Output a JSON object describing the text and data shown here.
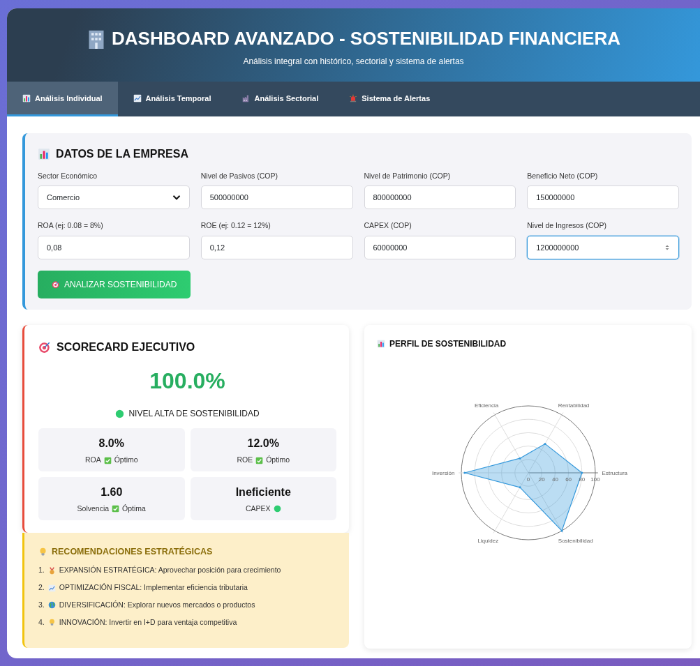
{
  "header": {
    "title": "DASHBOARD AVANZADO - SOSTENIBILIDAD FINANCIERA",
    "subtitle": "Análisis integral con histórico, sectorial y sistema de alertas"
  },
  "tabs": [
    {
      "label": "Análisis Individual",
      "selected": true,
      "kind": "bars"
    },
    {
      "label": "Análisis Temporal",
      "selected": false,
      "kind": "trend"
    },
    {
      "label": "Análisis Sectorial",
      "selected": false,
      "kind": "factory"
    },
    {
      "label": "Sistema de Alertas",
      "selected": false,
      "kind": "siren"
    }
  ],
  "form": {
    "title": "DATOS DE LA EMPRESA",
    "fields": [
      {
        "label": "Sector Económico",
        "kind": "select",
        "value": "Comercio",
        "focused": false
      },
      {
        "label": "Nivel de Pasivos (COP)",
        "kind": "text",
        "value": "500000000",
        "focused": false
      },
      {
        "label": "Nivel de Patrimonio (COP)",
        "kind": "text",
        "value": "800000000",
        "focused": false
      },
      {
        "label": "Beneficio Neto (COP)",
        "kind": "text",
        "value": "150000000",
        "focused": false
      },
      {
        "label": "ROA (ej: 0.08 = 8%)",
        "kind": "text",
        "value": "0,08",
        "focused": false
      },
      {
        "label": "ROE (ej: 0.12 = 12%)",
        "kind": "text",
        "value": "0,12",
        "focused": false
      },
      {
        "label": "CAPEX (COP)",
        "kind": "text",
        "value": "60000000",
        "focused": false
      },
      {
        "label": "Nivel de Ingresos (COP)",
        "kind": "number",
        "value": "1200000000",
        "focused": true
      }
    ],
    "button": "ANALIZAR SOSTENIBILIDAD"
  },
  "scorecard": {
    "title": "SCORECARD EJECUTIVO",
    "score": "100.0%",
    "level": "NIVEL ALTA DE SOSTENIBILIDAD",
    "metrics": [
      {
        "value": "8.0%",
        "label": "ROA",
        "kind": "check",
        "status": "Óptimo"
      },
      {
        "value": "12.0%",
        "label": "ROE",
        "kind": "check",
        "status": "Óptimo"
      },
      {
        "value": "1.60",
        "label": "Solvencia",
        "kind": "check",
        "status": "Óptima"
      },
      {
        "value": "Ineficiente",
        "label": "CAPEX",
        "kind": "dot",
        "color": "#2ecc71"
      }
    ]
  },
  "recommendations": {
    "title": "RECOMENDACIONES ESTRATÉGICAS",
    "items": [
      {
        "number": "1.",
        "kind": "medal",
        "text": "EXPANSIÓN ESTRATÉGICA: Aprovechar posición para crecimiento"
      },
      {
        "number": "2.",
        "kind": "chart",
        "text": "OPTIMIZACIÓN FISCAL: Implementar eficiencia tributaria"
      },
      {
        "number": "3.",
        "kind": "globe",
        "text": "DIVERSIFICACIÓN: Explorar nuevos mercados o productos"
      },
      {
        "number": "4.",
        "kind": "bulb",
        "text": "INNOVACIÓN: Invertir en I+D para ventaja competitiva"
      }
    ]
  },
  "profile": {
    "title": "PERFIL DE SOSTENIBILIDAD",
    "chart_data": {
      "type": "radar",
      "categories": [
        "Rentabilidad",
        "Estructura",
        "Sostenibilidad",
        "Liquidez",
        "Inversión",
        "Eficiencia"
      ],
      "series": [
        {
          "color": "#3498db",
          "values": [
            50,
            80,
            100,
            25,
            95,
            25
          ]
        }
      ],
      "ylim": [
        0,
        100
      ],
      "yticks": [
        0,
        20,
        40,
        60,
        80,
        100
      ]
    }
  }
}
